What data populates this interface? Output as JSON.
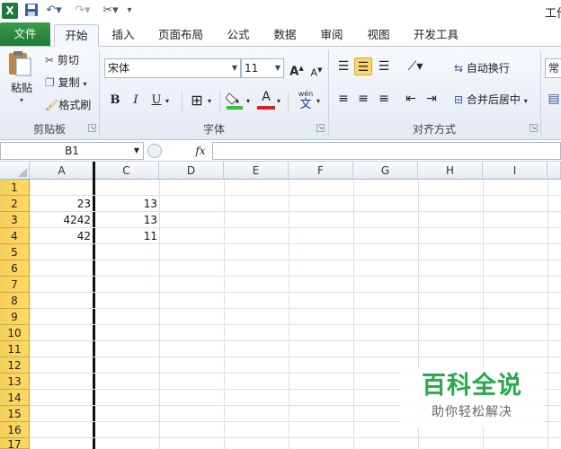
{
  "app": {
    "title": "工作"
  },
  "tabs": [
    "文件",
    "开始",
    "插入",
    "页面布局",
    "公式",
    "数据",
    "审阅",
    "视图",
    "开发工具"
  ],
  "clipboard": {
    "paste": "粘贴",
    "cut": "剪切",
    "copy": "复制",
    "format_painter": "格式刷",
    "group": "剪贴板"
  },
  "font": {
    "name": "宋体",
    "size": "11",
    "group": "字体",
    "bold": "B",
    "italic": "I",
    "underline": "U",
    "font_color_glyph": "A",
    "phonetic": "wén",
    "phonetic_char": "文"
  },
  "alignment": {
    "wrap_text": "自动换行",
    "merge_center": "合并后居中",
    "group": "对齐方式"
  },
  "number": {
    "format": "常"
  },
  "formula_bar": {
    "name_box": "B1",
    "fx": "fx",
    "value": ""
  },
  "columns": [
    "A",
    "C",
    "D",
    "E",
    "F",
    "G",
    "H",
    "I"
  ],
  "rows": [
    "1",
    "2",
    "3",
    "4",
    "5",
    "6",
    "7",
    "8",
    "9",
    "10",
    "11",
    "12",
    "13",
    "14",
    "15",
    "16",
    "17"
  ],
  "cells": [
    {
      "a": "",
      "c": ""
    },
    {
      "a": "23",
      "c": "13"
    },
    {
      "a": "4242",
      "c": "13"
    },
    {
      "a": "42",
      "c": "11"
    }
  ],
  "watermark": {
    "title": "百科全说",
    "subtitle": "助你轻松解决"
  },
  "colors": {
    "file_tab": "#1f7a35",
    "row_header": "#ffd963",
    "watermark": "#2aa84a"
  }
}
